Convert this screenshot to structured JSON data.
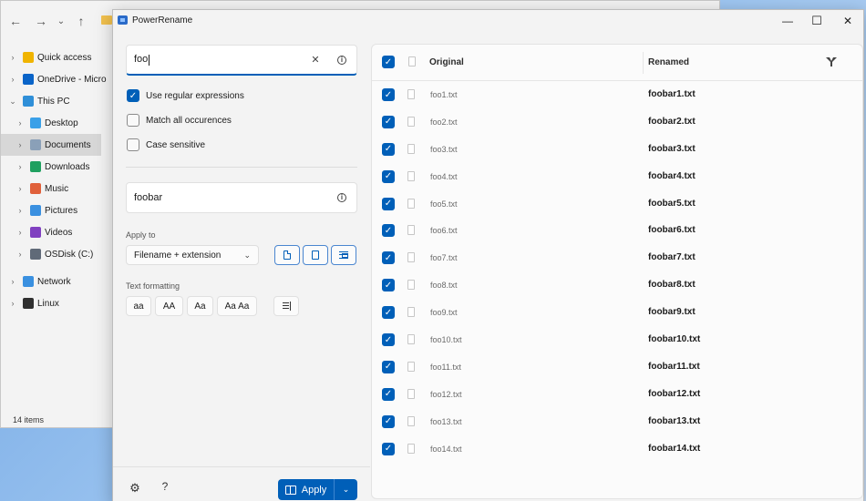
{
  "explorer": {
    "nav_back": "←",
    "nav_forward": "→",
    "nav_recent": "⌄",
    "nav_up": "↑",
    "tree": [
      {
        "label": "Quick access",
        "icon": "star-icon",
        "color": "#f0b400",
        "level": 0
      },
      {
        "label": "OneDrive - Micro",
        "icon": "cloud-icon",
        "color": "#0a64c8",
        "level": 0
      },
      {
        "label": "This PC",
        "icon": "pc-icon",
        "color": "#2f8fd8",
        "level": 0,
        "expanded": true
      },
      {
        "label": "Desktop",
        "icon": "desktop-icon",
        "color": "#3aa0e8",
        "level": 1
      },
      {
        "label": "Documents",
        "icon": "documents-icon",
        "color": "#8aa0b8",
        "level": 1,
        "selected": true
      },
      {
        "label": "Downloads",
        "icon": "downloads-icon",
        "color": "#20a060",
        "level": 1
      },
      {
        "label": "Music",
        "icon": "music-icon",
        "color": "#e0603a",
        "level": 1
      },
      {
        "label": "Pictures",
        "icon": "pictures-icon",
        "color": "#3a90e0",
        "level": 1
      },
      {
        "label": "Videos",
        "icon": "videos-icon",
        "color": "#8040c0",
        "level": 1
      },
      {
        "label": "OSDisk (C:)",
        "icon": "disk-icon",
        "color": "#606a78",
        "level": 1
      },
      {
        "label": "Network",
        "icon": "network-icon",
        "color": "#3a90e0",
        "level": 0
      },
      {
        "label": "Linux",
        "icon": "linux-icon",
        "color": "#303030",
        "level": 0
      }
    ],
    "status": "14 items"
  },
  "powerrename": {
    "title": "PowerRename",
    "window_controls": {
      "minimize": "—",
      "maximize": "☐",
      "close": "✕"
    },
    "search": {
      "value": "foo",
      "clear_glyph": "✕",
      "info_glyph": "i"
    },
    "options": [
      {
        "label": "Use regular expressions",
        "checked": true
      },
      {
        "label": "Match all occurences",
        "checked": false
      },
      {
        "label": "Case sensitive",
        "checked": false
      }
    ],
    "replace": {
      "value": "foobar",
      "info_glyph": "i"
    },
    "apply_to": {
      "label": "Apply to",
      "selected": "Filename + extension",
      "arrow": "⌄"
    },
    "text_formatting": {
      "label": "Text formatting",
      "buttons": [
        "aa",
        "AA",
        "Aa",
        "Aa Aa"
      ]
    },
    "help_glyph": "?",
    "gear_glyph": "⚙",
    "apply": {
      "label": "Apply",
      "arrow": "⌄"
    },
    "accent": "#005fb8",
    "list": {
      "col_original": "Original",
      "col_renamed": "Renamed",
      "rows": [
        {
          "original": "foo1.txt",
          "renamed": "foobar1.txt"
        },
        {
          "original": "foo2.txt",
          "renamed": "foobar2.txt"
        },
        {
          "original": "foo3.txt",
          "renamed": "foobar3.txt"
        },
        {
          "original": "foo4.txt",
          "renamed": "foobar4.txt"
        },
        {
          "original": "foo5.txt",
          "renamed": "foobar5.txt"
        },
        {
          "original": "foo6.txt",
          "renamed": "foobar6.txt"
        },
        {
          "original": "foo7.txt",
          "renamed": "foobar7.txt"
        },
        {
          "original": "foo8.txt",
          "renamed": "foobar8.txt"
        },
        {
          "original": "foo9.txt",
          "renamed": "foobar9.txt"
        },
        {
          "original": "foo10.txt",
          "renamed": "foobar10.txt"
        },
        {
          "original": "foo11.txt",
          "renamed": "foobar11.txt"
        },
        {
          "original": "foo12.txt",
          "renamed": "foobar12.txt"
        },
        {
          "original": "foo13.txt",
          "renamed": "foobar13.txt"
        },
        {
          "original": "foo14.txt",
          "renamed": "foobar14.txt"
        }
      ]
    }
  }
}
